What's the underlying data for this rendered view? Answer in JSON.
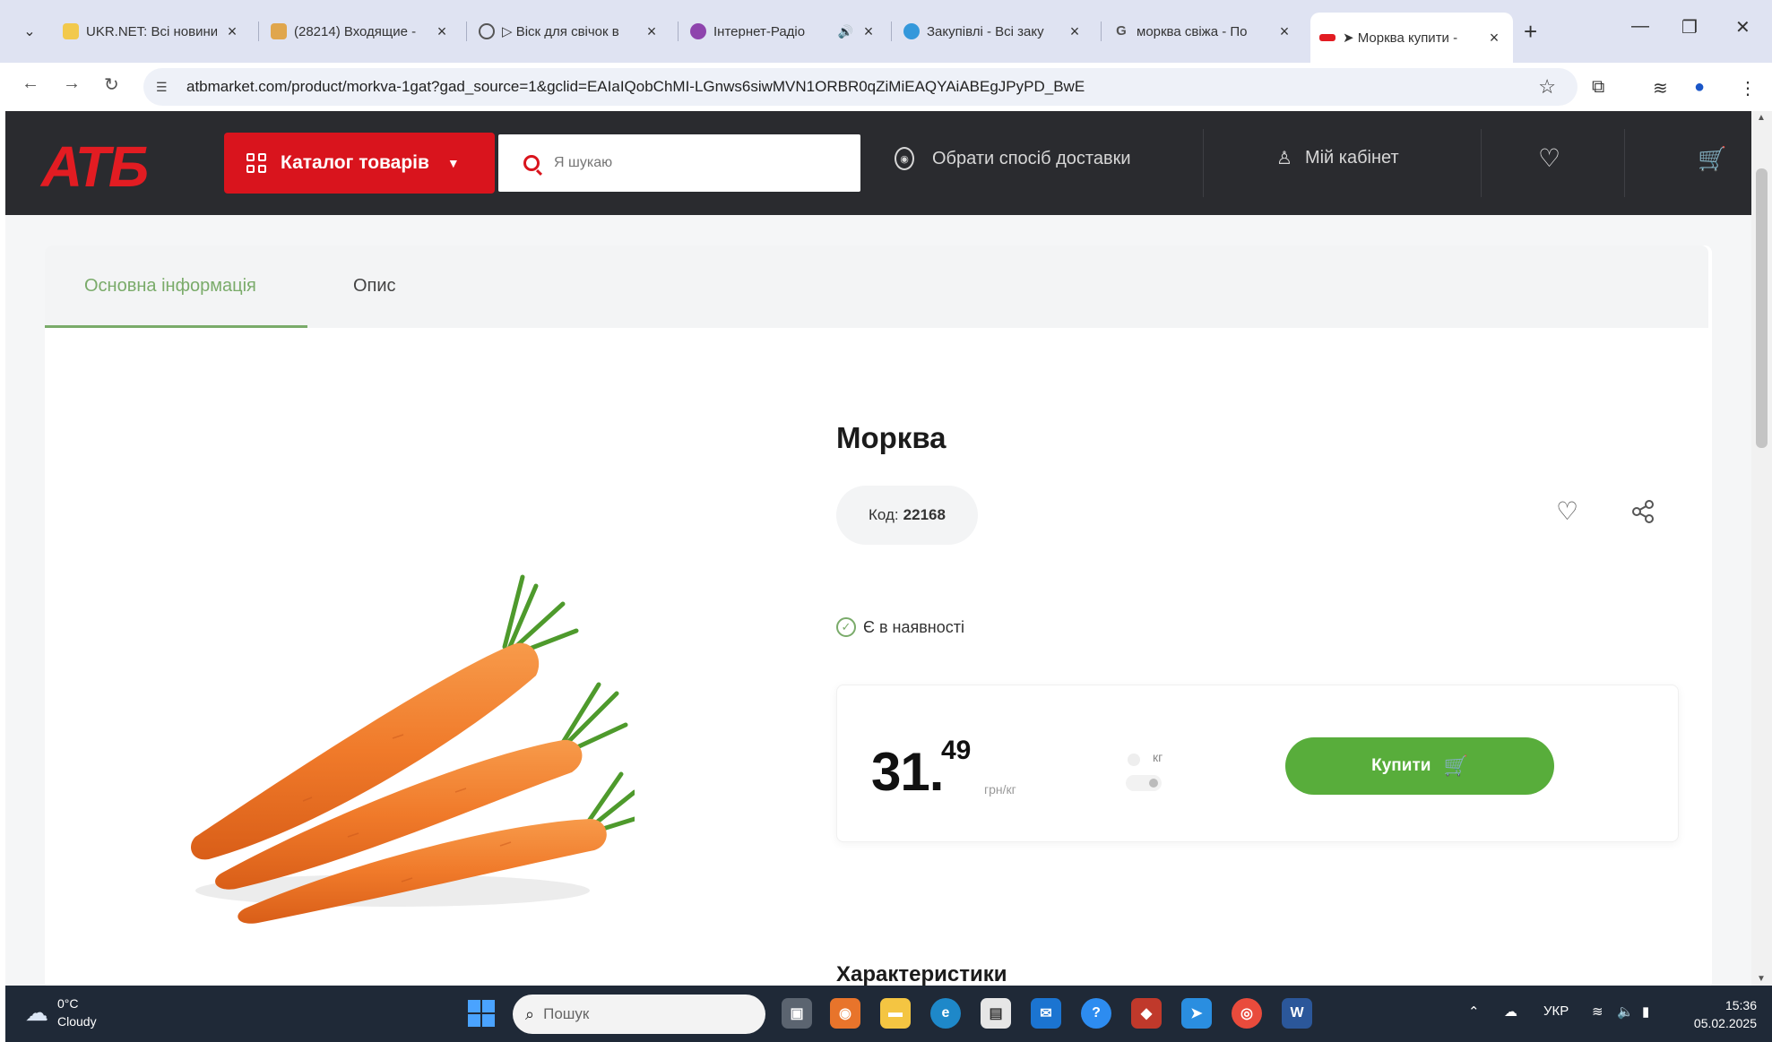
{
  "browser": {
    "tabs": [
      {
        "label": "UKR.NET: Всі новини",
        "favicon_color": "#f2c94c",
        "active": false
      },
      {
        "label": "(28214) Входящие -",
        "favicon_color": "#e0a64c",
        "active": false
      },
      {
        "label": "▷ Віск для свічок в",
        "favicon_color": "#555555",
        "active": false
      },
      {
        "label": "Інтернет-Радіо",
        "favicon_color": "#8e44ad",
        "active": false
      },
      {
        "label": "Закупівлі - Всі заку",
        "favicon_color": "#3498db",
        "active": false
      },
      {
        "label": "морква свіжа - По",
        "favicon_color": "#777777",
        "active": false
      },
      {
        "label": "➤ Морква купити -",
        "favicon_color": "#e21c22",
        "active": true
      }
    ],
    "new_tab_label": "+",
    "url": "atbmarket.com/product/morkva-1gat?gad_source=1&gclid=EAIaIQobChMI-LGnws6siwMVN1ORBR0qZiMiEAQYAiABEgJPyPD_BwE",
    "icons": {
      "back": "back-arrow-icon",
      "forward": "forward-arrow-icon",
      "reload": "reload-icon",
      "bookmark": "star-icon",
      "extensions": "puzzle-icon",
      "profile": "profile-icon",
      "menu": "kebab-icon"
    }
  },
  "site_header": {
    "logo_text": "АТБ",
    "catalog_label": "Каталог товарів",
    "search_placeholder": "Я шукаю",
    "delivery_label": "Обрати спосіб доставки",
    "account_label": "Мій кабінет"
  },
  "product": {
    "tabs": [
      {
        "label": "Основна інформація",
        "active": true
      },
      {
        "label": "Опис",
        "active": false
      }
    ],
    "title": "Морква",
    "code_label": "Код:",
    "code_value": "22168",
    "stock_label": "Є в наявності",
    "price_main": "31.",
    "price_cents": "49",
    "currency": "грн/кг",
    "unit_label": "кг",
    "buy_label": "Купити",
    "specs_title": "Характеристики"
  },
  "taskbar": {
    "weather_temp": "0°C",
    "weather_desc": "Cloudy",
    "search_placeholder": "Пошук",
    "language": "УКР",
    "time": "15:36",
    "date": "05.02.2025"
  },
  "colors": {
    "brand_red": "#e21c22",
    "header_dark": "#2a2b2f",
    "accent_green": "#58ad3b",
    "tab_green": "#7aab6a"
  }
}
